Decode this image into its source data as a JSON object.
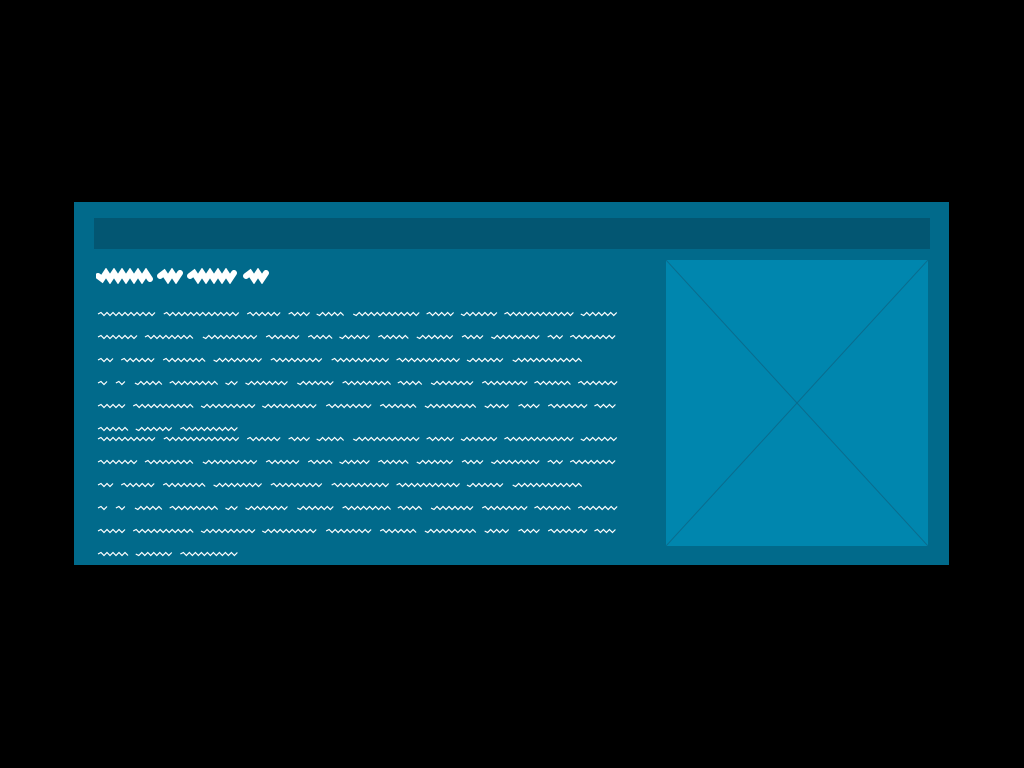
{
  "colors": {
    "background": "#000000",
    "card": "#016a8b",
    "header_bar": "#035672",
    "image_placeholder": "#0086ae",
    "placeholder_cross": "#0a6c8e",
    "scribble_text": "#ffffff"
  },
  "heading": {
    "word_count": 4
  },
  "paragraphs": [
    {
      "lines": [
        10,
        12,
        9,
        13,
        11,
        3
      ]
    },
    {
      "lines": [
        10,
        12,
        9,
        13,
        11,
        3
      ]
    }
  ]
}
